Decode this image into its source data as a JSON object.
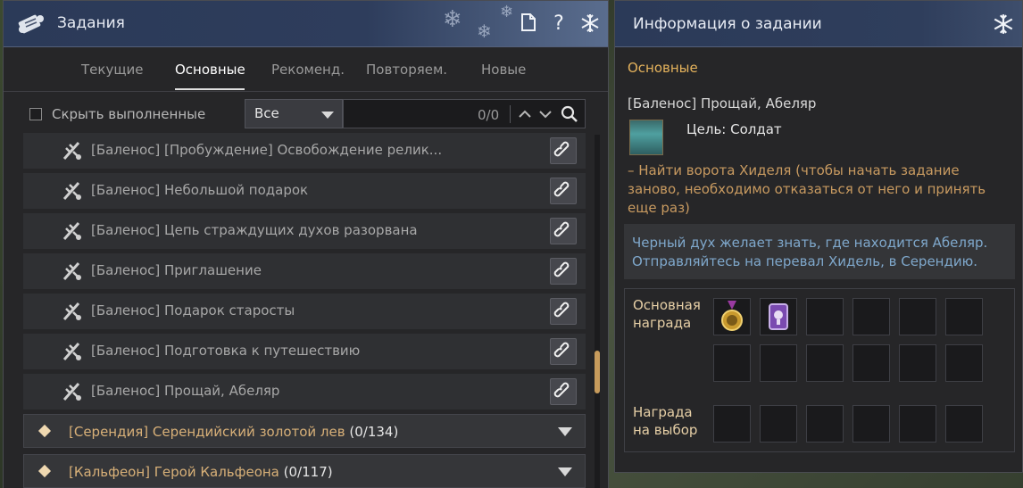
{
  "left_window": {
    "title": "Задания",
    "tabs": [
      {
        "label": "Текущие",
        "active": false
      },
      {
        "label": "Основные",
        "active": true
      },
      {
        "label": "Рекоменд.",
        "active": false
      },
      {
        "label": "Повторяем.",
        "active": false
      },
      {
        "label": "Новые",
        "active": false
      }
    ],
    "filter": {
      "hide_completed_label": "Скрыть выполненные",
      "hide_completed_checked": false,
      "select_value": "Все",
      "search_value": "",
      "search_count": "0/0"
    },
    "quests": [
      {
        "title": "[Баленос] [Пробуждение] Освобождение релик..."
      },
      {
        "title": "[Баленос] Небольшой подарок"
      },
      {
        "title": "[Баленос] Цепь страждущих духов разорвана"
      },
      {
        "title": "[Баленос] Приглашение"
      },
      {
        "title": "[Баленос] Подарок старосты"
      },
      {
        "title": "[Баленос] Подготовка к путешествию"
      },
      {
        "title": "[Баленос] Прощай, Абеляр"
      }
    ],
    "groups": [
      {
        "title": "[Серендия] Серендийский золотой лев",
        "count": "(0/134)"
      },
      {
        "title": "[Кальфеон] Герой Кальфеона",
        "count": "(0/117)"
      }
    ],
    "icons": {
      "window": "quest-scroll-icon",
      "page": "document-icon",
      "help": "help-icon",
      "pin": "snowflake-pin-icon",
      "quest": "quest-feather-icon",
      "link": "link-icon"
    }
  },
  "right_window": {
    "title": "Информация о задании",
    "category": "Основные",
    "quest_name": "[Баленос] Прощай, Абеляр",
    "target": "Цель: Солдат",
    "objective": "– Найти ворота Хиделя (чтобы начать задание заново, необходимо отказаться от него и принять еще раз)",
    "description": "Черный дух желает знать, где находится Абеляр. Отправляйтесь на перевал Хидель, в Серендию.",
    "rewards": {
      "main_label_line1": "Основная",
      "main_label_line2": "награда",
      "choice_label_line1": "Награда",
      "choice_label_line2": "на выбор",
      "main_items": [
        "gold-medal-icon",
        "purple-scroll-icon"
      ]
    }
  },
  "colors": {
    "titlebar": "#2b3a58",
    "accent_orange": "#e4b25c",
    "group_title": "#d8b078",
    "description_blue": "#7fa8cc",
    "objective_orange": "#c89a60"
  }
}
